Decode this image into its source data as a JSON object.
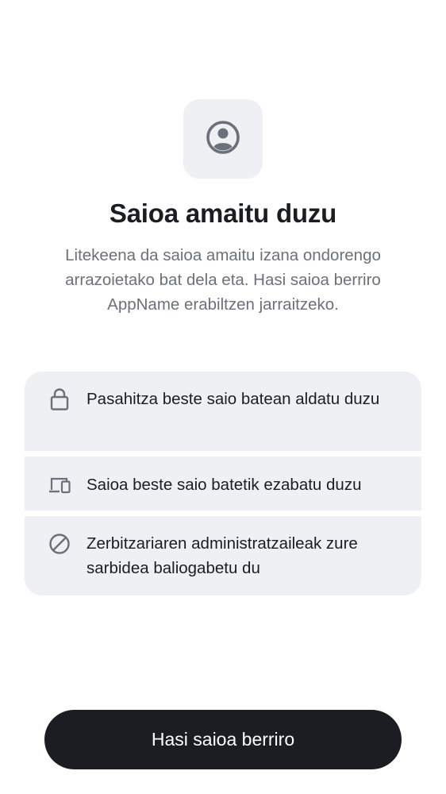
{
  "header": {
    "icon": "user-circle-icon",
    "title": "Saioa amaitu duzu",
    "subtitle": "Litekeena da saioa amaitu izana ondorengo arrazoietako bat dela eta. Hasi saioa berriro AppName erabiltzen jarraitzeko."
  },
  "reasons": [
    {
      "icon": "lock-icon",
      "text": "Pasahitza beste saio batean aldatu duzu"
    },
    {
      "icon": "devices-icon",
      "text": "Saioa beste saio batetik ezabatu duzu"
    },
    {
      "icon": "block-icon",
      "text": "Zerbitzariaren administratzaileak zure sarbidea baliogabetu du"
    }
  ],
  "actions": {
    "sign_in_again_label": "Hasi saioa berriro"
  },
  "colors": {
    "primary_text": "#1b1d22",
    "secondary_text": "#6b717b",
    "surface": "#eef0f3",
    "icon": "#6b717b",
    "button_bg": "#1b1d22",
    "button_text": "#ffffff"
  }
}
